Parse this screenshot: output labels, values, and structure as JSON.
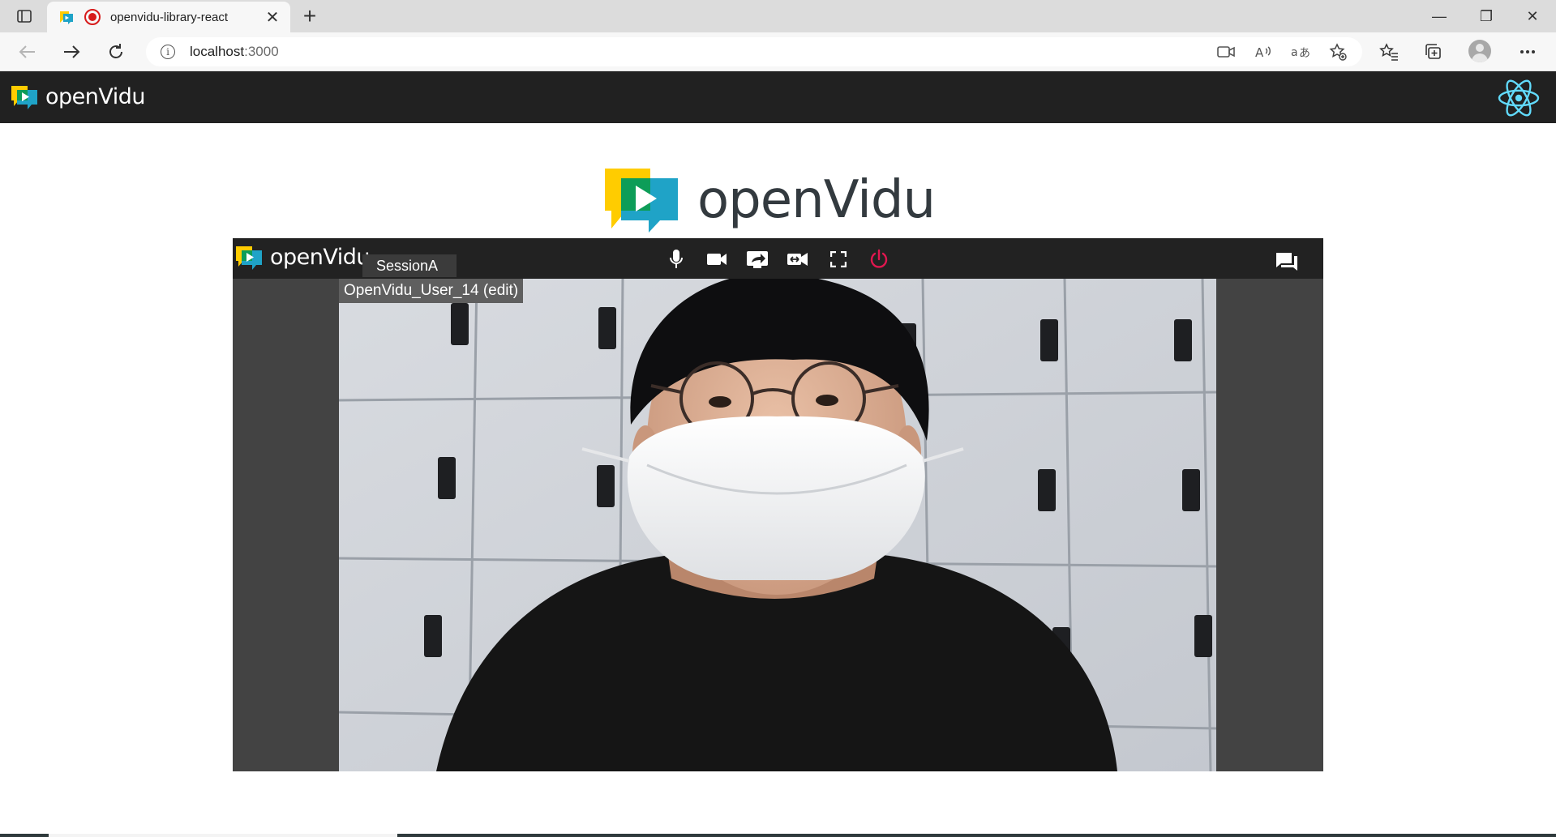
{
  "browser": {
    "tab": {
      "title": "openvidu-library-react",
      "favicon": "openvidu-favicon",
      "recording_indicator": "recording-icon",
      "close_glyph": "✕"
    },
    "new_tab_glyph": "+",
    "window_controls": {
      "minimize": "—",
      "restore": "❐",
      "close": "✕"
    },
    "address_bar": {
      "host": "localhost",
      "port": ":3000"
    },
    "toolbar_icons": [
      "back-icon",
      "forward-icon",
      "refresh-icon",
      "site-info-icon",
      "camera-in-use-icon",
      "read-aloud-icon",
      "translate-icon",
      "add-favorite-icon",
      "favorites-icon",
      "collections-icon",
      "profile-icon",
      "more-icon"
    ]
  },
  "app": {
    "header_logo_text": "openVidu",
    "framework_icon": "react-icon",
    "hero_logo_text": "openVidu",
    "room": {
      "logo_text": "openVidu",
      "session_name": "SessionA",
      "controls": [
        "microphone-icon",
        "camera-icon",
        "screen-share-icon",
        "switch-camera-icon",
        "fullscreen-icon",
        "leave-session-icon"
      ],
      "chat_icon": "chat-icon",
      "participant": {
        "nickname": "OpenVidu_User_14 (edit)"
      }
    }
  },
  "colors": {
    "header_bg": "#212121",
    "room_bg": "#434343",
    "room_toolbar_bg": "#222222",
    "leave_red": "#e0174f",
    "react_blue": "#61dafb",
    "logo_yellow": "#ffcc00",
    "logo_green": "#0d9d58",
    "logo_teal": "#1fa3c7"
  }
}
